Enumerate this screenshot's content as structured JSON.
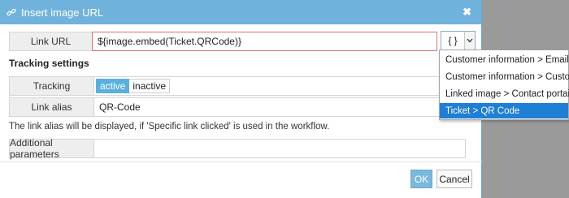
{
  "dialog": {
    "title": "Insert image URL",
    "close_glyph": "✖",
    "icon": "link-icon"
  },
  "link_url": {
    "label": "Link URL",
    "value": "${image.embed(Ticket.QRCode)}",
    "border_color": "#e07070"
  },
  "picker": {
    "value": "{ }",
    "arrow_glyph": "⌄",
    "options": [
      "Customer information > Email",
      "Customer information > Customer Id",
      "Linked image > Contact portait URL",
      "Ticket > QR Code"
    ],
    "selected_index": 3
  },
  "tracking_settings": {
    "title": "Tracking settings",
    "tracking_label": "Tracking",
    "active_label": "active",
    "inactive_label": "inactive",
    "link_alias_label": "Link alias",
    "link_alias_value": "QR-Code",
    "note": "The link alias will be displayed, if 'Specific link clicked' is used in the workflow."
  },
  "additional": {
    "label": "Additional parameters",
    "value": ""
  },
  "buttons": {
    "ok": "OK",
    "cancel": "Cancel"
  },
  "colors": {
    "titlebar": "#6fb3dc",
    "accent": "#5ab0dc",
    "selected": "#1e7fd4",
    "backdrop": "#9a9a9a"
  }
}
